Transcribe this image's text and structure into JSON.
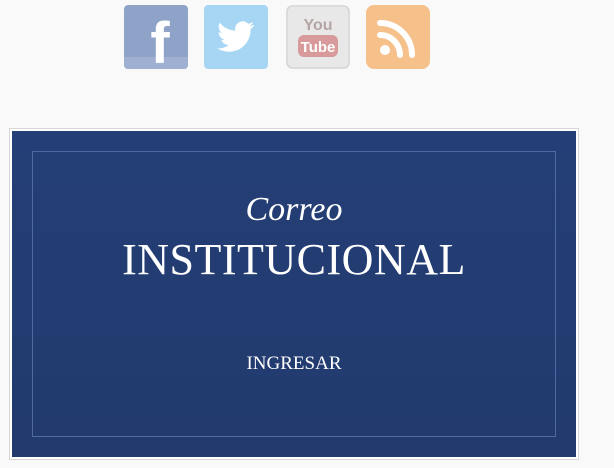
{
  "social_links": [
    {
      "network": "facebook",
      "icon": "facebook-icon",
      "glyph": "f",
      "color": "#8fa2c8"
    },
    {
      "network": "twitter",
      "icon": "twitter-icon",
      "color": "#a6d6f4"
    },
    {
      "network": "youtube",
      "icon": "youtube-icon",
      "text_top": "You",
      "text_bottom": "Tube",
      "color": "#e8e8e8"
    },
    {
      "network": "rss",
      "icon": "rss-icon",
      "color": "#f5c08a"
    }
  ],
  "mail_card": {
    "subtitle": "Correo",
    "title": "INSTITUCIONAL",
    "button_label": "INGRESAR",
    "background_color": "#233d72",
    "border_color": "#4f6aa0"
  }
}
